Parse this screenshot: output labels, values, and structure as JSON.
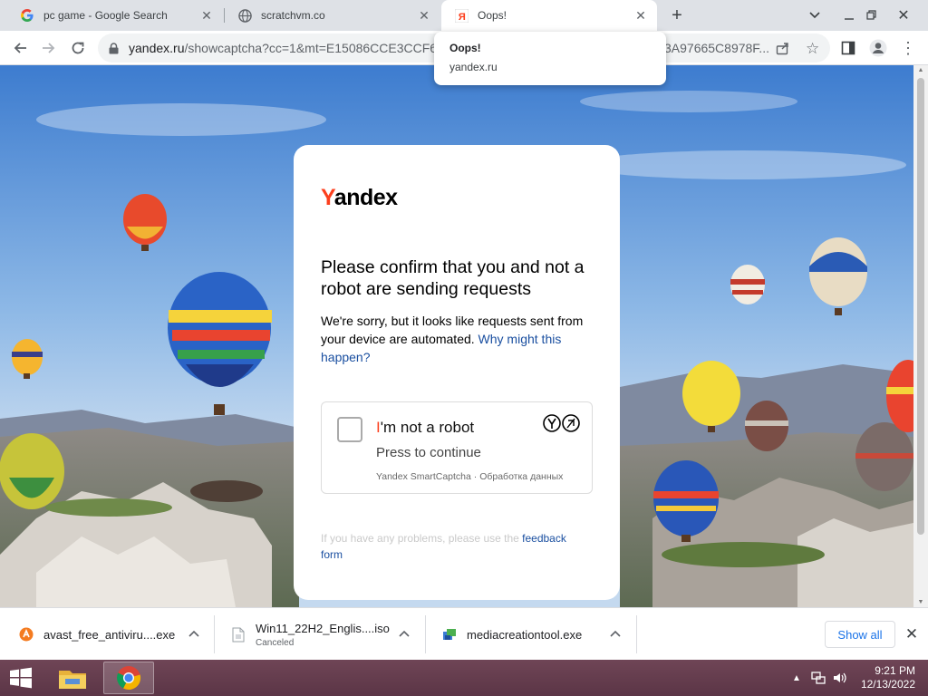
{
  "browser": {
    "tabs": [
      {
        "title": "pc game - Google Search",
        "favicon": "google-g-icon"
      },
      {
        "title": "scratchvm.co",
        "favicon": "globe-icon"
      },
      {
        "title": "Oops!",
        "favicon": "yandex-y-icon",
        "active": true
      }
    ],
    "new_tab": "+",
    "address": {
      "domain": "yandex.ru",
      "path_start": "/showcaptcha?cc=1&mt=E15086CCE3CCF6B",
      "path_end": "3A97665C8978F..."
    },
    "hover_card": {
      "title": "Oops!",
      "domain": "yandex.ru"
    }
  },
  "page": {
    "logo": {
      "first": "Y",
      "rest": "andex"
    },
    "heading": "Please confirm that you and not a robot are sending requests",
    "description": "We're sorry, but it looks like requests sent from your device are automated. ",
    "description_link": "Why might this happen?",
    "captcha": {
      "robot_first": "I",
      "robot_rest": "'m not a robot",
      "press": "Press to continue",
      "brand": "Yandex SmartCaptcha · Обработка данных"
    },
    "feedback_text": "If you have any problems, please use the ",
    "feedback_link_1": "feedback",
    "feedback_link_2": "form"
  },
  "downloads": {
    "items": [
      {
        "name": "avast_free_antiviru....exe",
        "status": "",
        "icon": "avast-icon"
      },
      {
        "name": "Win11_22H2_Englis....iso",
        "status": "Canceled",
        "icon": "file-icon"
      },
      {
        "name": "mediacreationtool.exe",
        "status": "",
        "icon": "installer-icon"
      }
    ],
    "show_all": "Show all"
  },
  "taskbar": {
    "time": "9:21 PM",
    "date": "12/13/2022"
  },
  "colors": {
    "yandex_red": "#fc3f1d",
    "link_blue": "#1a4fa0",
    "chrome_blue": "#1a73e8"
  }
}
